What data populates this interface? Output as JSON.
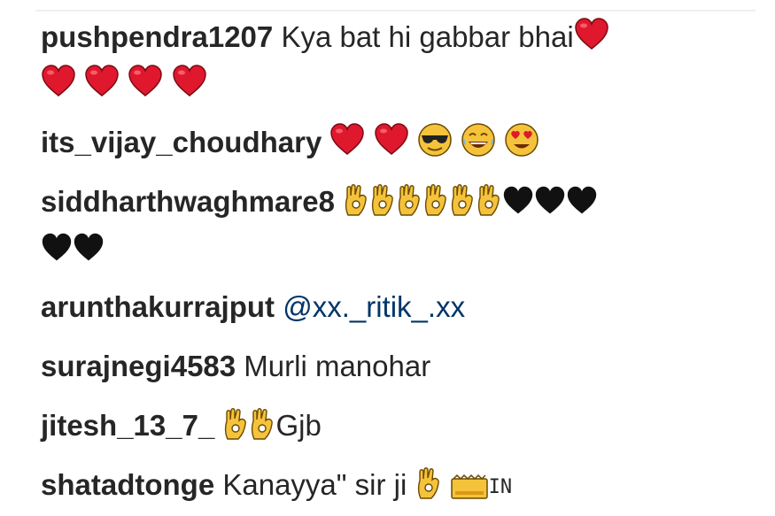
{
  "comments": [
    {
      "username": "pushpendra1207",
      "text": "Kya bat hi gabbar bhai"
    },
    {
      "username": "its_vijay_choudhary",
      "text": ""
    },
    {
      "username": "siddharthwaghmare8",
      "text": ""
    },
    {
      "username": "arunthakurrajput",
      "text": "@xx._ritik_.xx"
    },
    {
      "username": "surajnegi4583",
      "text": "Murli manohar"
    },
    {
      "username": "jitesh_13_7_",
      "text": "Gjb"
    },
    {
      "username": "shatadtonge",
      "text": "Kanayya\" sir ji",
      "suffix": "IN"
    }
  ],
  "emoji_names": {
    "red_heart": "red-heart-icon",
    "black_heart": "black-heart-icon",
    "ok_hand": "ok-hand-icon",
    "sunglasses_face": "sunglasses-face-icon",
    "joy_face": "tears-of-joy-face-icon",
    "heart_eyes_face": "heart-eyes-face-icon",
    "crown": "crown-icon"
  },
  "colors": {
    "username": "#262626",
    "mention": "#003569",
    "heart_red": "#e0182d",
    "emoji_yellow": "#f5c33b"
  }
}
